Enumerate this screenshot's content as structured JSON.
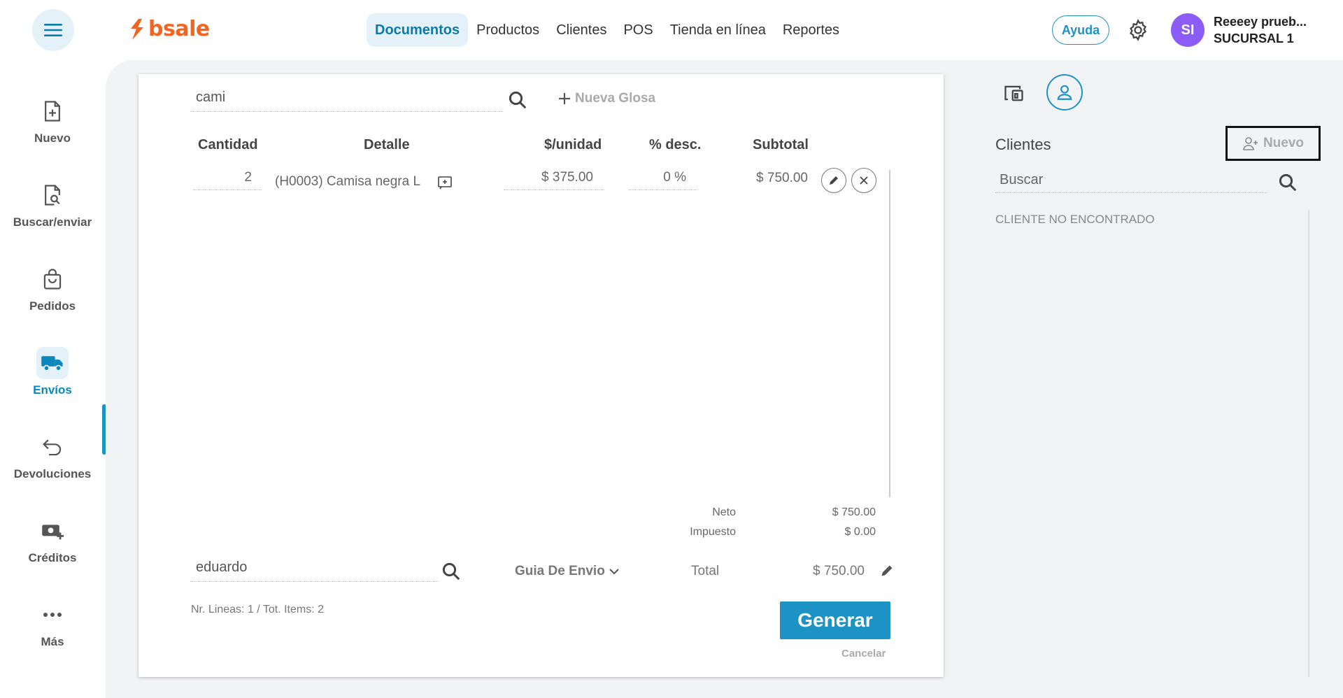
{
  "topbar": {
    "logo_text": "bsale",
    "nav": [
      "Documentos",
      "Productos",
      "Clientes",
      "POS",
      "Tienda en línea",
      "Reportes"
    ],
    "help_label": "Ayuda",
    "avatar_initials": "SI",
    "user_name": "Reeeey prueb...",
    "branch": "SUCURSAL 1"
  },
  "sidebar": {
    "items": [
      {
        "label": "Nuevo",
        "icon": "file-plus-icon"
      },
      {
        "label": "Buscar/enviar",
        "icon": "file-search-icon"
      },
      {
        "label": "Pedidos",
        "icon": "shopping-bag-icon"
      },
      {
        "label": "Envíos",
        "icon": "truck-icon",
        "active": true
      },
      {
        "label": "Devoluciones",
        "icon": "return-arrow-icon"
      },
      {
        "label": "Créditos",
        "icon": "money-plus-icon"
      },
      {
        "label": "Más",
        "icon": "more-dots-icon"
      }
    ]
  },
  "document": {
    "product_search_value": "cami",
    "new_glosa_label": "Nueva Glosa",
    "columns": [
      "Cantidad",
      "Detalle",
      "$/unidad",
      "% desc.",
      "Subtotal"
    ],
    "rows": [
      {
        "qty": "2",
        "detail": "(H0003) Camisa negra L",
        "unit_price": "$ 375.00",
        "discount": "0 %",
        "subtotal": "$ 750.00"
      }
    ],
    "neto_label": "Neto",
    "neto_value": "$ 750.00",
    "impuesto_label": "Impuesto",
    "impuesto_value": "$ 0.00",
    "client_search_value": "eduardo",
    "doc_type": "Guia De Envio",
    "total_label": "Total",
    "total_value": "$ 750.00",
    "line_summary": "Nr. Lineas: 1 / Tot. Items: 2",
    "generate_label": "Generar",
    "cancel_label": "Cancelar"
  },
  "right_panel": {
    "title": "Clientes",
    "new_label": "Nuevo",
    "search_placeholder": "Buscar",
    "not_found": "CLIENTE NO ENCONTRADO"
  },
  "colors": {
    "accent": "#1c93c4",
    "brand": "#f5641e",
    "avatar": "#8b5cf6"
  }
}
